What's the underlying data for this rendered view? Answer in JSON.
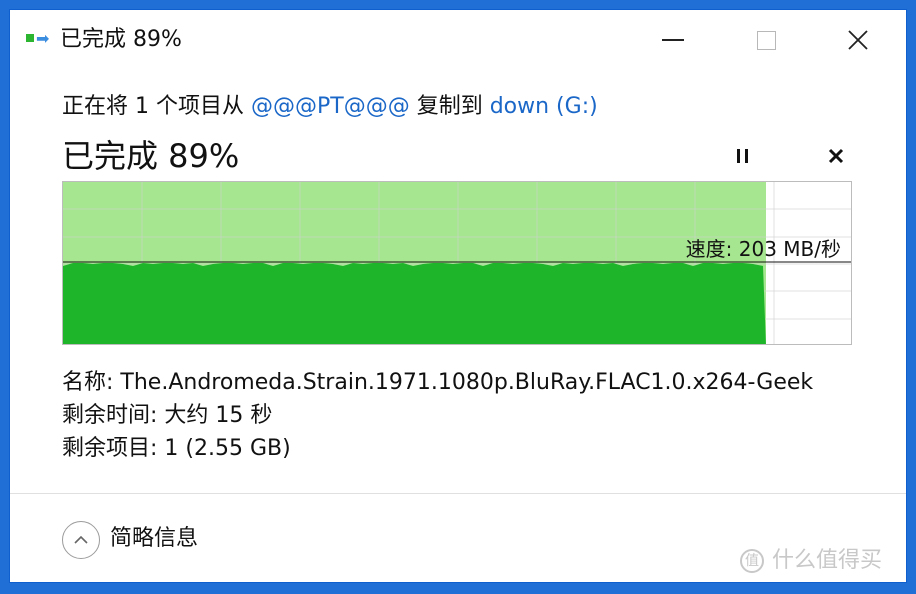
{
  "titlebar": {
    "title": "已完成 89%",
    "icons": {
      "app": "copy-progress-icon",
      "minimize": "minimize-icon",
      "maximize": "maximize-icon",
      "close": "close-icon"
    }
  },
  "copy": {
    "prefix": "正在将 1 个项目从 ",
    "source": "@@@PT@@@",
    "middle": " 复制到 ",
    "destination": "down (G:)"
  },
  "status": {
    "text": "已完成 89%",
    "progress_percent": 89
  },
  "controls": {
    "pause_icon": "pause-icon",
    "cancel_icon": "cancel-icon"
  },
  "graph": {
    "speed_text": "速度: 203 MB/秒",
    "colors": {
      "fill_dark": "#1fb52a",
      "fill_light": "#a6e690",
      "grid": "#cfcfcf"
    }
  },
  "info": {
    "name_label": "名称:",
    "name_value": "The.Andromeda.Strain.1971.1080p.BluRay.FLAC1.0.x264-Geek",
    "time_label": "剩余时间:",
    "time_value": "大约 15 秒",
    "items_label": "剩余项目:",
    "items_value": "1 (2.55 GB)"
  },
  "footer": {
    "details_label": "简略信息",
    "details_icon": "chevron-up-icon"
  },
  "watermark": {
    "text": "什么值得买",
    "logo_glyph": "值"
  }
}
